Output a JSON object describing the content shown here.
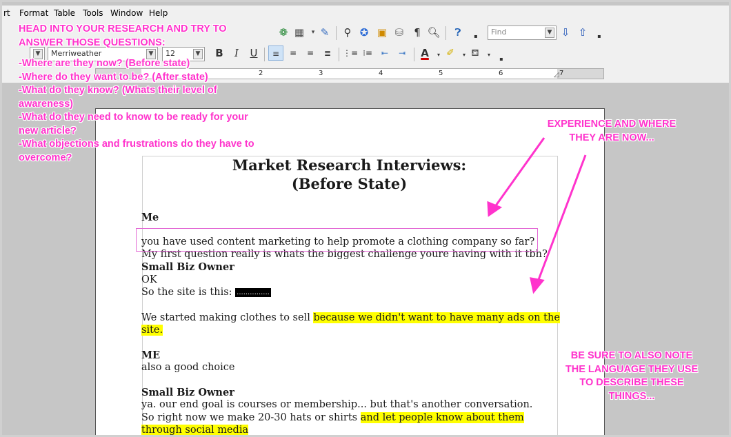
{
  "menubar": {
    "items": [
      "rt",
      "Format",
      "Table",
      "Tools",
      "Window",
      "Help"
    ]
  },
  "toolbar": {
    "find_placeholder": "Find",
    "font_name": "Merriweather",
    "font_size": "12",
    "bold_label": "B",
    "italic_label": "I",
    "underline_label": "U"
  },
  "ruler": {
    "numbers": [
      "2",
      "3",
      "4",
      "5",
      "6",
      "7"
    ]
  },
  "document": {
    "title_line1": "Market Research Interviews:",
    "title_line2": "(Before State)",
    "speaker_me": "Me",
    "line1": "you have used content marketing to help promote a clothing company so far?",
    "line2": "My first question really is whats the biggest challenge youre having with it tbh?",
    "speaker_owner1": "Small Biz Owner",
    "line3": "OK",
    "line4_prefix": "So the site is this: ",
    "redacted": "...............",
    "line5_plain": "We started making clothes to sell ",
    "line5_highlight": "because we didn't want to have many ads on the",
    "line6_highlight": "site.",
    "speaker_me2": "ME",
    "line7": "also a good choice",
    "speaker_owner2": "Small Biz Owner",
    "line8": "ya. our end goal is courses or membership... but that's another conversation.",
    "line9_plain": "So right now we make 20-30 hats or shirts ",
    "line9_highlight": "and let people know about them",
    "line10_highlight": "through social media"
  },
  "annotations": {
    "left_lines": [
      "HEAD INTO YOUR RESEARCH AND TRY TO",
      "ANSWER THOSE QUESTIONS:",
      "",
      "-Where are they now? (Before state)",
      "-Where do they want to be? (After state)",
      "-What do they know? (Whats their level of",
      "awareness)",
      "-What do they need to know to be ready for your",
      "new article?",
      "-What objections and frustrations do they have to",
      "overcome?"
    ],
    "right_top": [
      "EXPERIENCE AND WHERE",
      "THEY ARE NOW..."
    ],
    "right_bottom": [
      "BE SURE TO ALSO NOTE",
      "THE LANGUAGE THEY USE",
      "TO DESCRIBE THESE",
      "THINGS..."
    ]
  },
  "colors": {
    "annotation": "#ff33cc",
    "highlight": "#ffff00",
    "annotation_box": "#e36ad5"
  }
}
